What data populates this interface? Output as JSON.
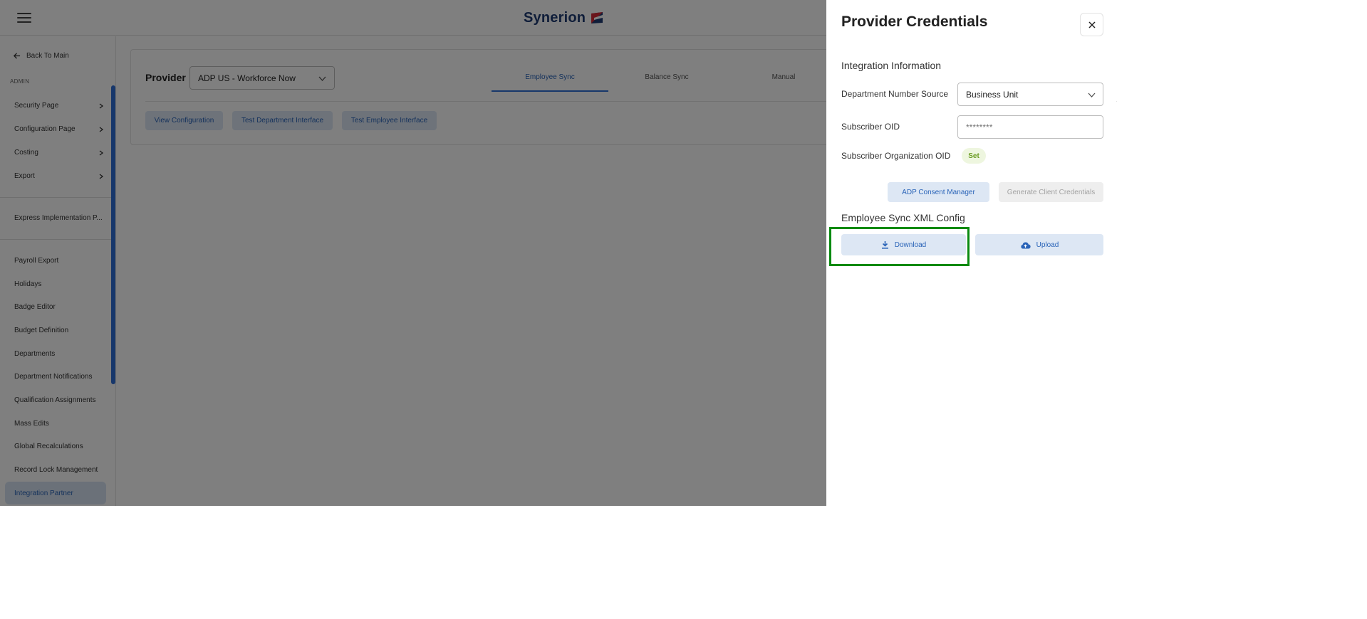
{
  "header": {
    "logo_text": "Synerion"
  },
  "sidebar": {
    "back_label": "Back To Main",
    "section_label": "ADMIN",
    "expandable_items": [
      {
        "label": "Security Page"
      },
      {
        "label": "Configuration Page"
      },
      {
        "label": "Costing"
      },
      {
        "label": "Export"
      }
    ],
    "express_item": "Express Implementation P...",
    "items": [
      {
        "label": "Payroll Export"
      },
      {
        "label": "Holidays"
      },
      {
        "label": "Badge Editor"
      },
      {
        "label": "Budget Definition"
      },
      {
        "label": "Departments"
      },
      {
        "label": "Department Notifications"
      },
      {
        "label": "Qualification Assignments"
      },
      {
        "label": "Mass Edits"
      },
      {
        "label": "Global Recalculations"
      },
      {
        "label": "Record Lock Management"
      },
      {
        "label": "Integration Partner"
      }
    ],
    "active_item": "Integration Partner"
  },
  "main": {
    "provider_label": "Provider",
    "provider_value": "ADP US - Workforce Now",
    "tabs": [
      {
        "label": "Employee Sync"
      },
      {
        "label": "Balance Sync"
      },
      {
        "label": "Manual"
      }
    ],
    "active_tab": "Employee Sync",
    "buttons": {
      "view_config": "View Configuration",
      "test_department": "Test Department Interface",
      "test_employee": "Test Employee Interface"
    }
  },
  "drawer": {
    "title": "Provider Credentials",
    "integration_section": "Integration Information",
    "department_source_label": "Department Number Source",
    "department_source_value": "Business Unit",
    "subscriber_oid_label": "Subscriber OID",
    "subscriber_oid_placeholder": "********",
    "subscriber_org_label": "Subscriber Organization OID",
    "subscriber_org_status": "Set",
    "consent_button": "ADP Consent Manager",
    "generate_button": "Generate Client Credentials",
    "xml_section": "Employee Sync XML Config",
    "download_button": "Download",
    "upload_button": "Upload"
  },
  "colors": {
    "accent": "#2f6fd6",
    "button_bg": "#dde7f4",
    "button_text": "#2a64b8",
    "highlight": "#0a8a10",
    "badge_bg": "#eef6df",
    "badge_text": "#6b9c23"
  },
  "icons": {
    "menu": "hamburger-icon",
    "back": "arrow-left-icon",
    "chevron_right": "chevron-right-icon",
    "chevron_down": "chevron-down-icon",
    "close": "close-icon",
    "download": "download-icon",
    "upload": "cloud-upload-icon",
    "logo_flag": "logo-flag-icon"
  }
}
